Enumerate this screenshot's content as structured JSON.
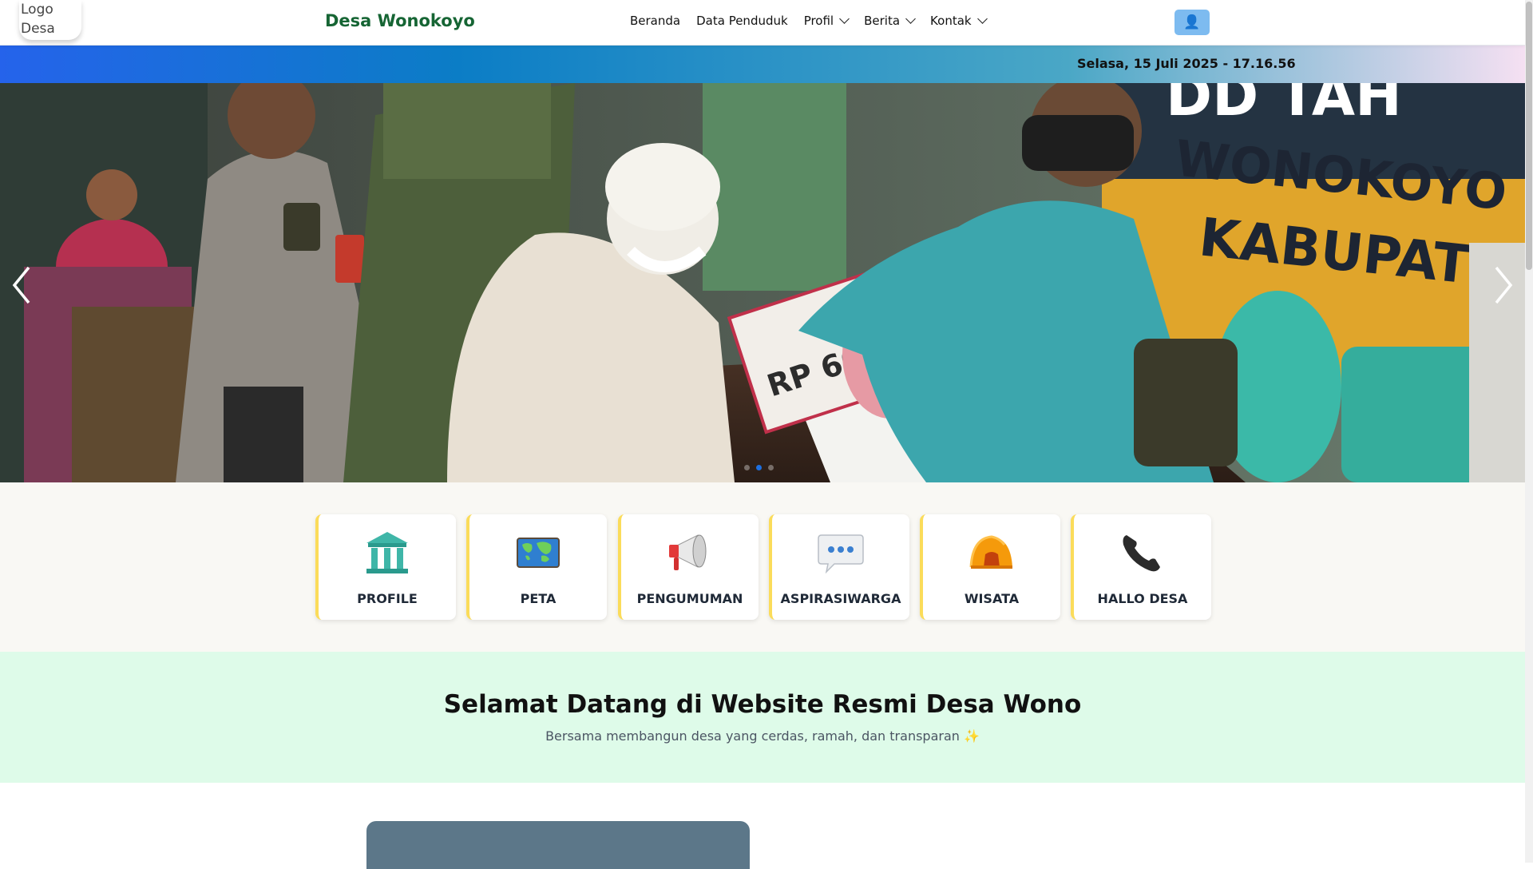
{
  "navbar": {
    "logo_alt": "Logo Desa",
    "brand": "Desa Wonokoyo",
    "menu": [
      {
        "label": "Beranda",
        "dropdown": false
      },
      {
        "label": "Data Penduduk",
        "dropdown": false
      },
      {
        "label": "Profil",
        "dropdown": true
      },
      {
        "label": "Berita",
        "dropdown": true
      },
      {
        "label": "Kontak",
        "dropdown": true
      }
    ],
    "user_icon": "👤"
  },
  "datebar": {
    "datetime": "Selasa, 15 Juli 2025 - 17.16.56"
  },
  "hero": {
    "banner_text_1": "WONOKOYO KECA",
    "banner_text_2": "KABUPATEN S",
    "banner_text_top": "DD TAH",
    "poster_amount": "RP 600",
    "slides": 3,
    "active_slide": 2
  },
  "quick_menu": [
    {
      "label": "PROFILE",
      "icon": "bank-building-icon"
    },
    {
      "label": "PETA",
      "icon": "world-map-icon"
    },
    {
      "label": "PENGUMUMAN",
      "icon": "megaphone-icon"
    },
    {
      "label": "ASPIRASIWARGA",
      "icon": "speech-bubble-icon"
    },
    {
      "label": "WISATA",
      "icon": "tent-icon"
    },
    {
      "label": "HALLO DESA",
      "icon": "phone-icon"
    }
  ],
  "welcome": {
    "title": "Selamat Datang di Website Resmi Desa Wono",
    "subtitle": "Bersama membangun desa yang cerdas, ramah, dan transparan",
    "sparkle": "✨"
  },
  "colors": {
    "brand_green": "#166534",
    "card_accent": "#fbdc5a",
    "welcome_bg": "#defbe9",
    "user_button": "#7dbbf0"
  }
}
